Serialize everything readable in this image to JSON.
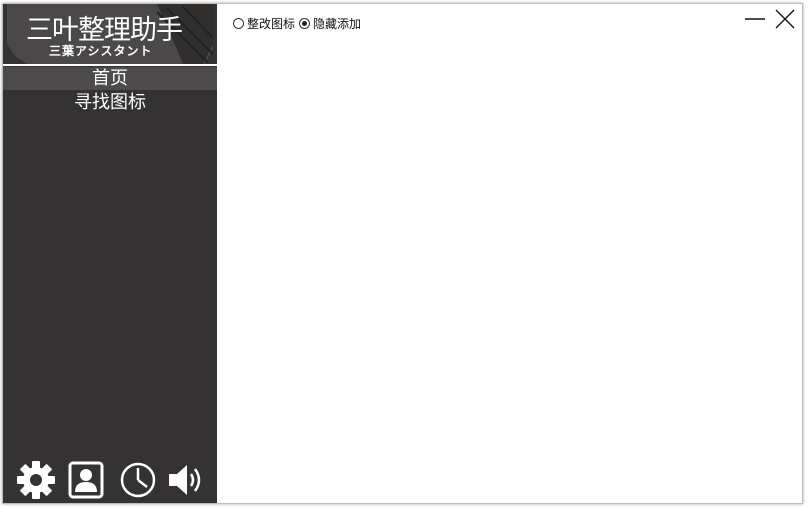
{
  "app": {
    "title": "三叶整理助手",
    "subtitle": "三葉アシスタント"
  },
  "sidebar": {
    "items": [
      {
        "label": "首页",
        "active": true
      },
      {
        "label": "寻找图标",
        "active": false
      }
    ],
    "bottom_icons": [
      "gear-icon",
      "user-icon",
      "clock-icon",
      "speaker-icon"
    ]
  },
  "main": {
    "options": [
      {
        "label": "整改图标",
        "checked": false
      },
      {
        "label": "隐藏添加",
        "checked": true
      }
    ]
  },
  "window_controls": [
    "minimize-icon",
    "close-icon"
  ],
  "colors": {
    "sidebar_bg": "#343232",
    "active_item_bg": "#4d4b4b",
    "text_light": "#ffffff",
    "main_bg": "#ffffff"
  }
}
